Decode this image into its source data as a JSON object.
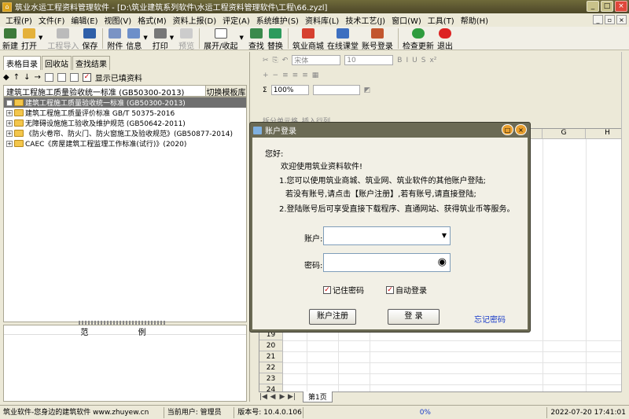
{
  "window": {
    "title": "筑业水运工程资料管理软件 - [D:\\筑业建筑系列软件\\水运工程资料管理软件\\工程\\66.zyzl]"
  },
  "menu": [
    "工程(P)",
    "文件(F)",
    "编辑(E)",
    "视图(V)",
    "格式(M)",
    "资料上报(D)",
    "评定(A)",
    "系统维护(S)",
    "资料库(L)",
    "技术工艺(J)",
    "窗口(W)",
    "工具(T)",
    "帮助(H)"
  ],
  "toolbar": {
    "new": "新建",
    "open": "打开",
    "import": "工程导入",
    "save": "保存",
    "attach": "附件",
    "info": "信息",
    "print": "打印",
    "preview": "预览",
    "expand": "展开/收起",
    "find": "查找",
    "replace": "替换",
    "mall": "筑业商城",
    "classroom": "在线课堂",
    "account": "账号登录",
    "update": "检查更新",
    "exit": "退出"
  },
  "left": {
    "tabs": [
      "表格目录",
      "回收站",
      "查找结果"
    ],
    "show_filled": "显示已填资料",
    "standard": "建筑工程施工质量验收统一标准 (GB50300-2013)",
    "switch_lib": "切换模板库",
    "tree": [
      "建筑工程施工质量验收统一标准 (GB50300-2013)",
      "建筑工程施工质量评价标准 GB/T 50375-2016",
      "无障碍设施施工验收及维护规范 (GB50642-2011)",
      "《防火卷帘、防火门、防火窗施工及验收规范》(GB50877-2014)",
      "CAEC《房屋建筑工程监理工作标准(试行)》(2020)"
    ],
    "example_title": "范 例"
  },
  "format": {
    "font": "宋体",
    "size": "10",
    "zoom": "100%",
    "merge": "拆分单元格",
    "rowcol": "插入行列"
  },
  "grid": {
    "col_g": "G",
    "col_h": "H",
    "rows": [
      "19",
      "20",
      "21",
      "22",
      "23",
      "24"
    ],
    "sheet_tab": "第1页"
  },
  "dialog": {
    "title": "账户登录",
    "greeting": "您好:",
    "welcome": "欢迎使用筑业资料软件!",
    "line1": "1.您可以使用筑业商城、筑业网、筑业软件的其他账户登陆;",
    "line1b": "若没有账号,请点击【账户注册】,若有账号,请直接登陆;",
    "line2": "2.登陆账号后可享受直接下载程序、直通网站、获得筑业币等服务。",
    "account_label": "账户:",
    "password_label": "密码:",
    "remember": "记住密码",
    "autologin": "自动登录",
    "register": "账户注册",
    "login": "登 录",
    "forgot": "忘记密码"
  },
  "status": {
    "company": "筑业软件-您身边的建筑软件 www.zhuyew.cn",
    "user": "当前用户: 管理员",
    "version": "版本号: 10.4.0.106",
    "progress": "0%",
    "datetime": "2022-07-20 17:41:01"
  }
}
